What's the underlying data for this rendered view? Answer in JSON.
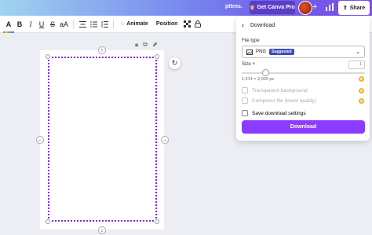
{
  "topbar": {
    "brand": "pttrns.",
    "pro_button": "Get Canva Pro",
    "plus": "+",
    "share_label": "Share"
  },
  "toolbar": {
    "text_color": "A",
    "bold": "B",
    "italic": "I",
    "underline": "U",
    "strikethrough": "S",
    "case": "aA",
    "animate_label": "Animate",
    "position_label": "Position"
  },
  "canvas": {
    "page_icons": [
      "lock-icon",
      "duplicate-icon",
      "add-page-icon"
    ]
  },
  "download_panel": {
    "title": "Download",
    "file_type_label": "File type",
    "file_type_value": "PNG",
    "suggested_badge": "Suggested",
    "size_label": "Size ×",
    "size_value": "1",
    "dimensions": "1,414 × 2,000 px",
    "options": [
      {
        "label": "Transparent background",
        "pro": true,
        "enabled": false
      },
      {
        "label": "Compress file (lower quality)",
        "pro": true,
        "enabled": false
      },
      {
        "label": "Save download settings",
        "pro": false,
        "enabled": true
      }
    ],
    "download_button": "Download",
    "accent_color": "#8b3dff"
  }
}
